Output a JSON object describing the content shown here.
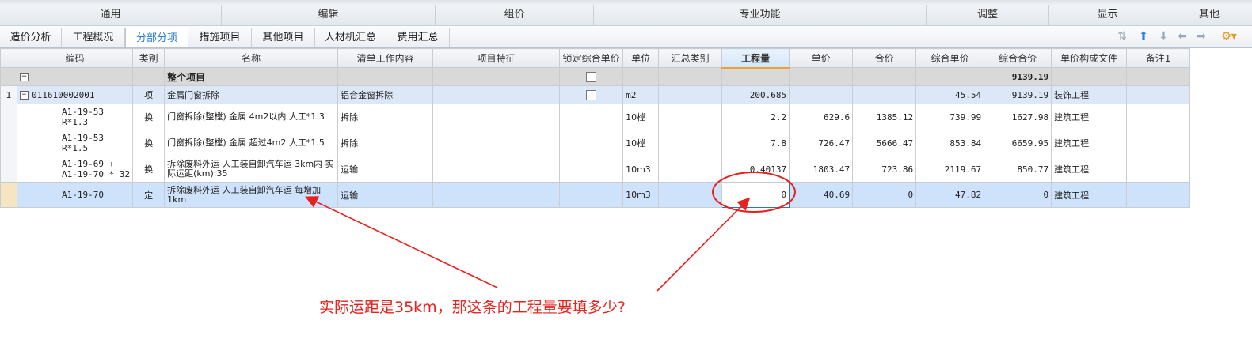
{
  "ribbon": {
    "groups": [
      "通用",
      "编辑",
      "组价",
      "专业功能",
      "调整",
      "显示",
      "其他"
    ]
  },
  "tabs": [
    "造价分析",
    "工程概况",
    "分部分项",
    "措施项目",
    "其他项目",
    "人材机汇总",
    "费用汇总"
  ],
  "active_tab": "分部分项",
  "toolbar_icons": [
    "sort-icon",
    "move-up-icon",
    "move-down-icon",
    "move-left-icon",
    "move-right-icon",
    "settings-icon"
  ],
  "columns": [
    "编码",
    "类别",
    "名称",
    "清单工作内容",
    "项目特征",
    "锁定综合单价",
    "单位",
    "汇总类别",
    "工程量",
    "单价",
    "合价",
    "综合单价",
    "综合合价",
    "单价构成文件",
    "备注1"
  ],
  "total_row": {
    "name": "整个项目",
    "total": "9139.19"
  },
  "item_row": {
    "rownum": "1",
    "code": "011610002001",
    "type": "项",
    "name": "金属门窗拆除",
    "work": "铝合金窗拆除",
    "unit": "m2",
    "qty": "200.685",
    "comp_price": "45.54",
    "comp_total": "9139.19",
    "file": "装饰工程"
  },
  "sub_rows": [
    {
      "code": "A1-19-53\nR*1.3",
      "type": "换",
      "name": "门窗拆除(整樘) 金属  4m2以内 人工*1.3",
      "work": "拆除",
      "unit": "10樘",
      "qty": "2.2",
      "price": "629.6",
      "total": "1385.12",
      "comp_price": "739.99",
      "comp_total": "1627.98",
      "file": "建筑工程"
    },
    {
      "code": "A1-19-53\nR*1.5",
      "type": "换",
      "name": "门窗拆除(整樘) 金属  超过4m2 人工*1.5",
      "work": "拆除",
      "unit": "10樘",
      "qty": "7.8",
      "price": "726.47",
      "total": "5666.47",
      "comp_price": "853.84",
      "comp_total": "6659.95",
      "file": "建筑工程"
    },
    {
      "code": "A1-19-69 +\nA1-19-70 * 32",
      "type": "换",
      "name": "拆除废料外运 人工装自卸汽车运 3km内 实际运距(km):35",
      "work": "运输",
      "unit": "10m3",
      "qty": "0.40137",
      "price": "1803.47",
      "total": "723.86",
      "comp_price": "2119.67",
      "comp_total": "850.77",
      "file": "建筑工程"
    }
  ],
  "selected_row": {
    "code": "A1-19-70",
    "type": "定",
    "name": "拆除废料外运 人工装自卸汽车运 每增加1km",
    "work": "运输",
    "unit": "10m3",
    "qty": "0",
    "price": "40.69",
    "total": "0",
    "comp_price": "47.82",
    "comp_total": "0",
    "file": "建筑工程"
  },
  "annotation": {
    "question": "实际运距是35km，那这条的工程量要填多少?",
    "color": "#e8211c"
  }
}
